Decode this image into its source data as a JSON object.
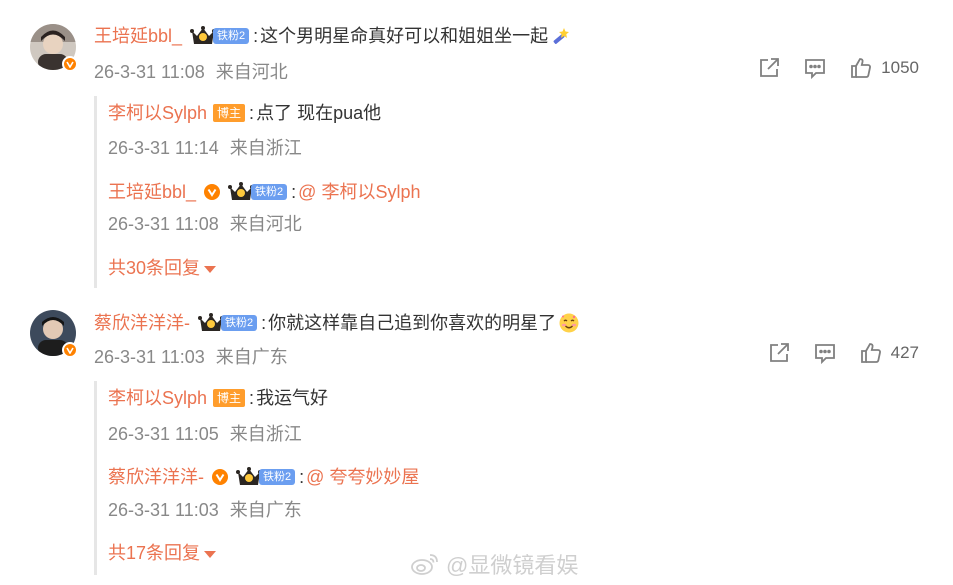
{
  "comments": [
    {
      "user": "王培延bbl_",
      "fan_badge": "铁粉2",
      "text": "这个男明星命真好可以和姐姐坐一起",
      "emoji": "magic-wand",
      "time": "26-3-31 11:08",
      "location": "来自河北",
      "likes": "1050",
      "replies": [
        {
          "user": "李柯以Sylph",
          "host_badge": "博主",
          "text": "点了 现在pua他",
          "time": "26-3-31 11:14",
          "location": "来自浙江"
        },
        {
          "user": "王培延bbl_",
          "fan_badge": "铁粉2",
          "mention": "@ 李柯以Sylph",
          "time": "26-3-31 11:08",
          "location": "来自河北"
        }
      ],
      "more_replies": "共30条回复"
    },
    {
      "user": "蔡欣洋洋洋-",
      "fan_badge": "铁粉2",
      "text": "你就这样靠自己追到你喜欢的明星了",
      "emoji": "smiling-face",
      "time": "26-3-31 11:03",
      "location": "来自广东",
      "likes": "427",
      "replies": [
        {
          "user": "李柯以Sylph",
          "host_badge": "博主",
          "text": "我运气好",
          "time": "26-3-31 11:05",
          "location": "来自浙江"
        },
        {
          "user": "蔡欣洋洋洋-",
          "fan_badge": "铁粉2",
          "mention": "@ 夸夸妙妙屋",
          "time": "26-3-31 11:03",
          "location": "来自广东"
        }
      ],
      "more_replies": "共17条回复"
    }
  ],
  "watermark": "@显微镜看娱",
  "colors": {
    "username": "#eb7350",
    "meta": "#888888",
    "fan_pill": "#6b9ef0",
    "host_badge": "#ff9d2c",
    "verified": "#ff8200"
  }
}
